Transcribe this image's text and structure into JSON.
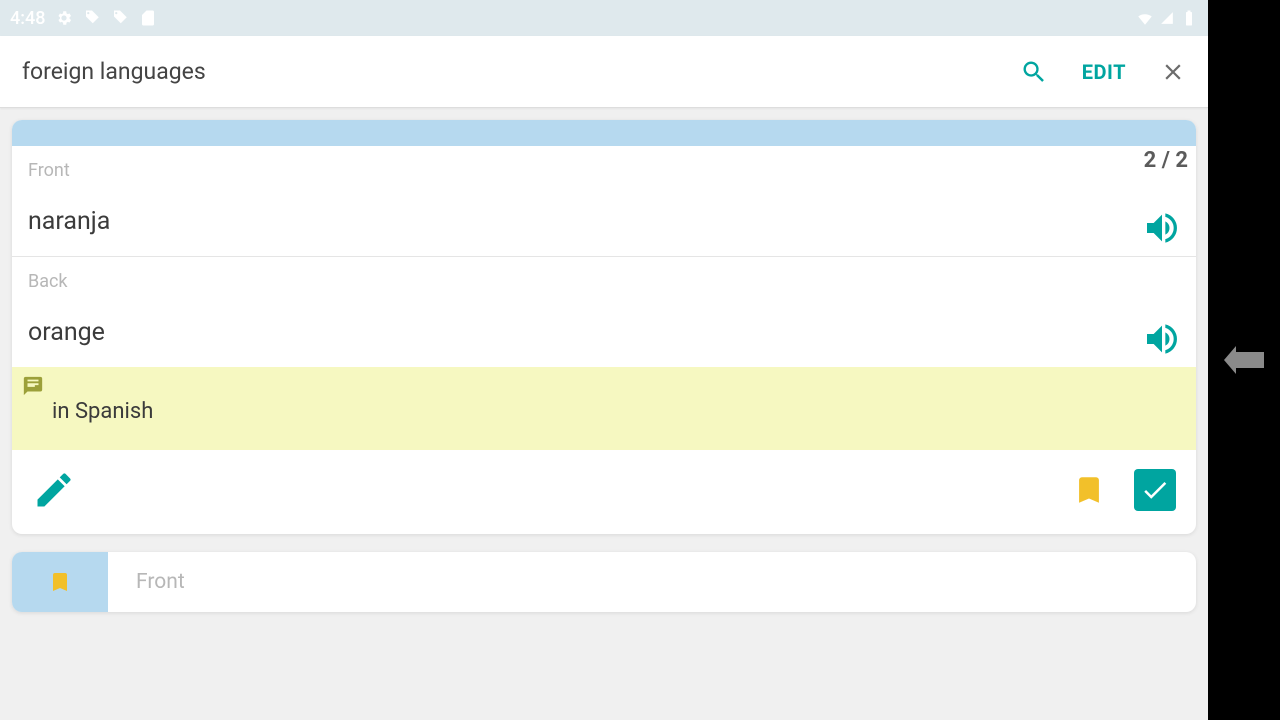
{
  "statusbar": {
    "time": "4:48"
  },
  "appbar": {
    "title": "foreign languages",
    "edit_label": "EDIT"
  },
  "card": {
    "counter": "2 / 2",
    "front_label": "Front",
    "front_text": "naranja",
    "back_label": "Back",
    "back_text": "orange",
    "note_text": "in Spanish"
  },
  "card2": {
    "front_label": "Front"
  }
}
